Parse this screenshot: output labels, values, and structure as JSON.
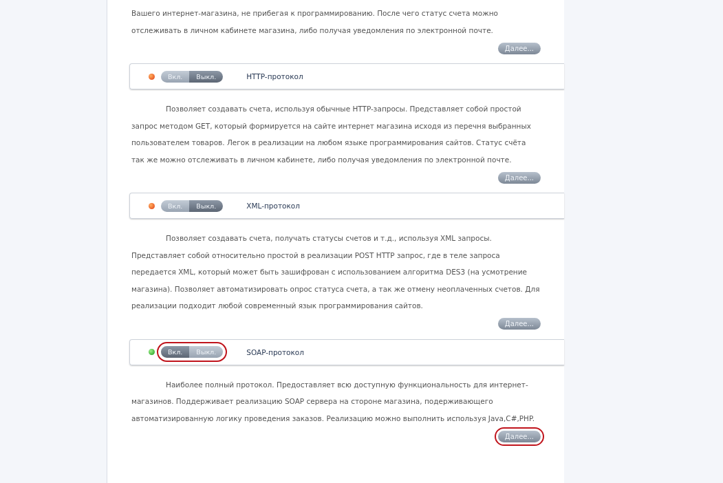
{
  "intro": {
    "text": "Вашего интернет-магазина, не прибегая к программированию. После чего статус счета можно отслеживать в личном кабинете магазина, либо получая уведомления по электронной почте.",
    "more": "Далее...",
    "more_circled": false
  },
  "protocols": [
    {
      "title": "HTTP-протокол",
      "on": false,
      "on_label": "Вкл.",
      "off_label": "Выкл.",
      "toggle_circled": false,
      "text": "Позволяет создавать счета, используя обычные HTTP-запросы. Представляет собой простой запрос методом GET, который формируется на сайте интернет магазина исходя из перечня выбранных пользователем товаров. Легок в реализации на любом языке программирования сайтов. Статус счёта так же можно отслеживать в личном кабинете, либо получая уведомления по электронной почте.",
      "more": "Далее...",
      "more_circled": false
    },
    {
      "title": "XML-протокол",
      "on": false,
      "on_label": "Вкл.",
      "off_label": "Выкл.",
      "toggle_circled": false,
      "text": "Позволяет создавать счета, получать статусы счетов и т.д., используя XML запросы. Представляет собой относительно простой в реализации POST HTTP запрос, где в теле запроса передается XML, который может быть зашифрован с использованием алгоритма DES3 (на усмотрение магазина). Позволяет автоматизировать опрос статуса счета, а так же отмену неоплаченных счетов. Для реализации подходит любой современный язык программирования сайтов.",
      "more": "Далее...",
      "more_circled": false
    },
    {
      "title": "SOAP-протокол",
      "on": true,
      "on_label": "Вкл.",
      "off_label": "Выкл.",
      "toggle_circled": true,
      "text": "Наиболее полный протокол. Предоставляет всю доступную функциональность для интернет-магазинов. Поддерживает реализацию SOAP сервера на стороне магазина, подерживающего автоматизированную логику проведения заказов. Реализацию можно выполнить используя Java,C#,PHP.",
      "more": "Далее...",
      "more_circled": true
    }
  ]
}
